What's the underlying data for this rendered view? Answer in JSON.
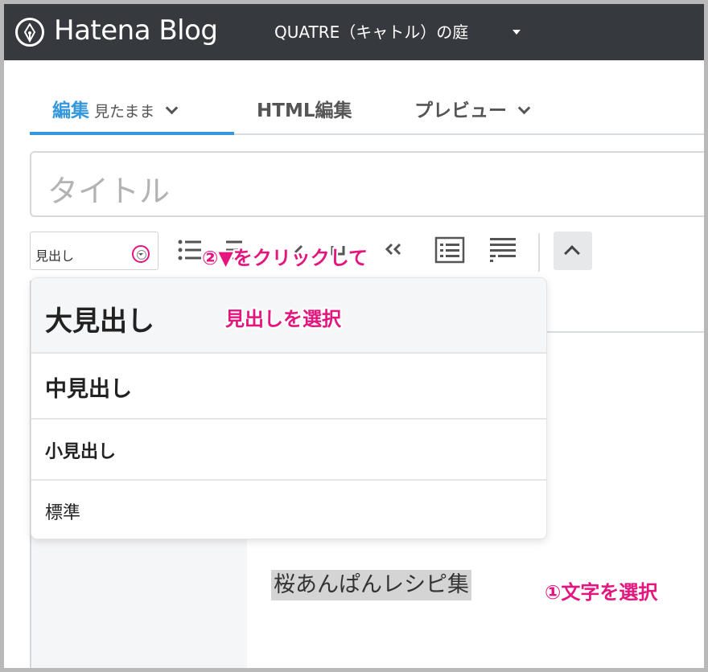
{
  "header": {
    "brand": "Hatena Blog",
    "blog_name": "QUATRE（キャトル）の庭"
  },
  "tabs": {
    "edit_label": "編集",
    "edit_mode": "見たまま",
    "html_label": "HTML編集",
    "preview_label": "プレビュー"
  },
  "editor": {
    "title_placeholder": "タイトル",
    "heading_select_value": "見出し",
    "body_selected_text": "桜あんぱんレシピ集"
  },
  "dropdown": {
    "items": [
      "大見出し",
      "中見出し",
      "小見出し",
      "標準"
    ]
  },
  "annotations": {
    "click_hint": "②▼をクリックして",
    "select_heading_hint": "見出しを選択",
    "select_text_hint": "①文字を選択"
  },
  "colors": {
    "topbar": "#36393d",
    "accent": "#3598dc",
    "annotation": "#e4157e"
  },
  "icons": [
    "hatena-pen-icon",
    "chevron-down-icon",
    "bullet-list-icon",
    "numbered-list-icon",
    "link-icon",
    "undo-icon",
    "blockquote-icon",
    "list-box-icon",
    "text-format-icon",
    "chevron-up-icon"
  ]
}
